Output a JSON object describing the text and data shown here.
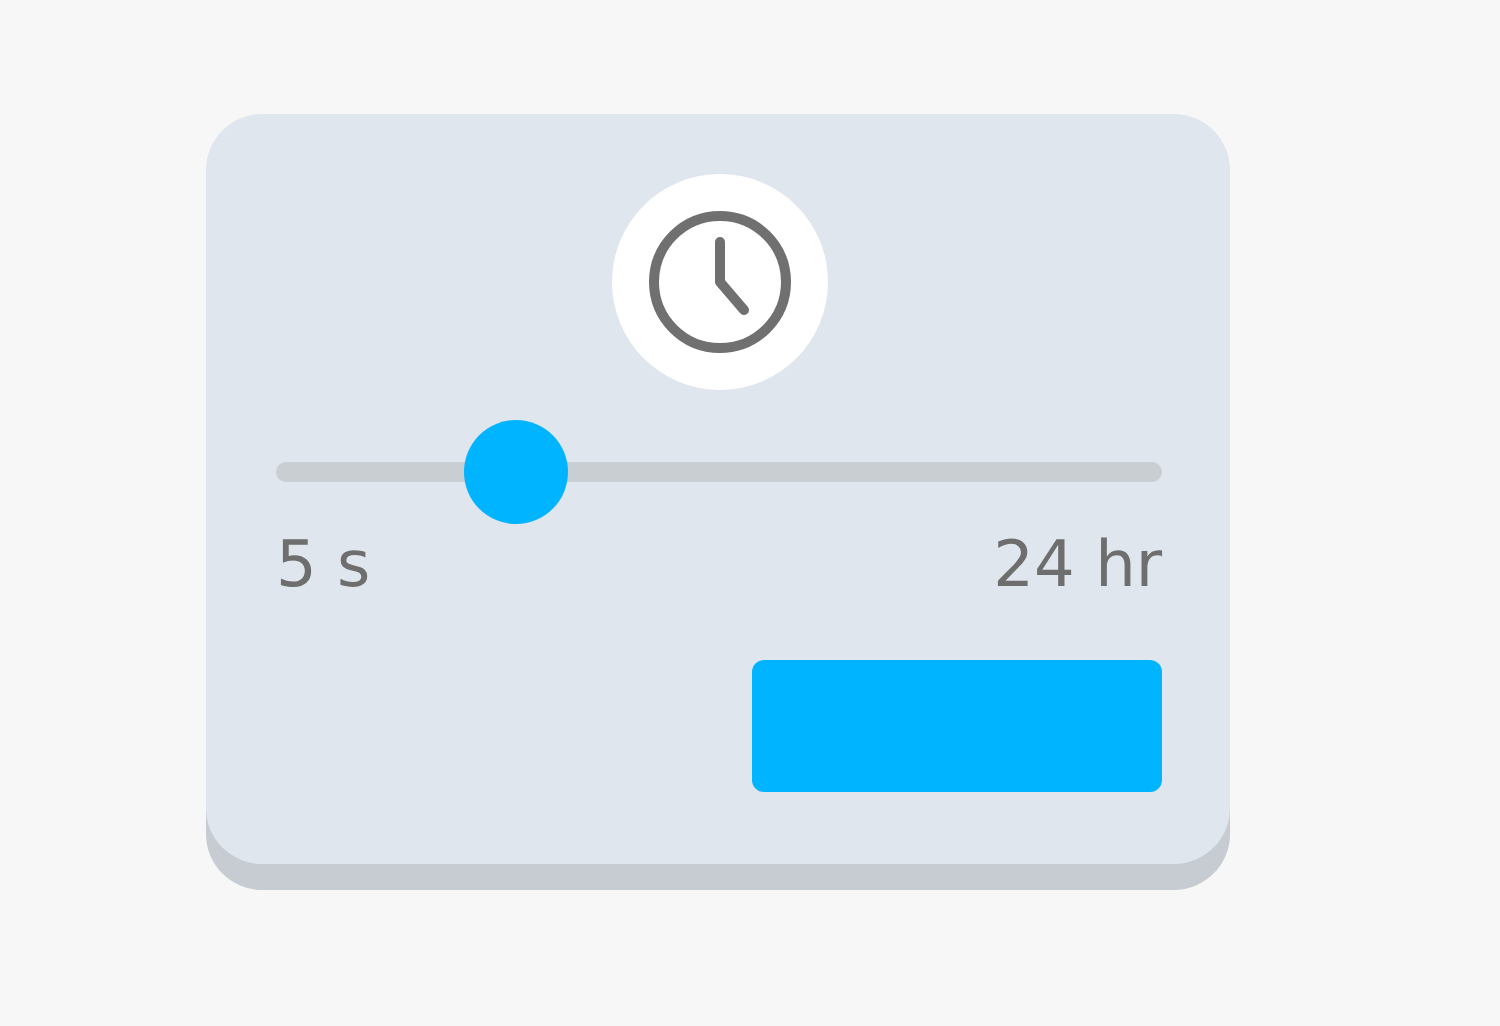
{
  "slider": {
    "level": 0.27,
    "min_label": "5 s",
    "max_label": "24 hr"
  }
}
